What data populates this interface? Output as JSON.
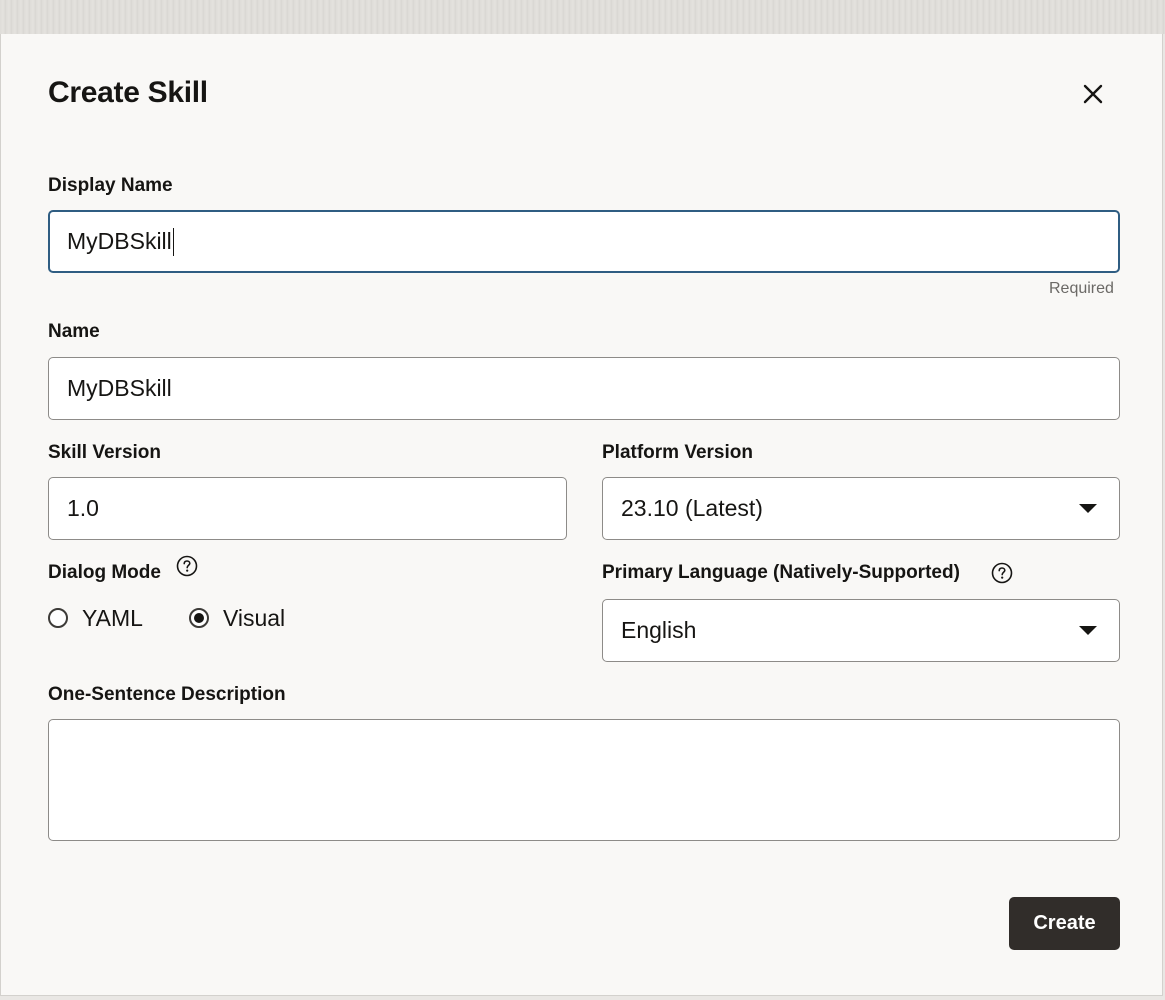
{
  "dialog": {
    "title": "Create Skill",
    "close_icon": "close-icon",
    "create_label": "Create"
  },
  "display_name": {
    "label": "Display Name",
    "value": "MyDBSkill",
    "helper": "Required"
  },
  "name": {
    "label": "Name",
    "value": "MyDBSkill"
  },
  "skill_version": {
    "label": "Skill Version",
    "value": "1.0"
  },
  "platform_version": {
    "label": "Platform Version",
    "selected": "23.10 (Latest)"
  },
  "dialog_mode": {
    "label": "Dialog Mode",
    "help_icon": "help-icon",
    "options": [
      {
        "label": "YAML",
        "selected": false
      },
      {
        "label": "Visual",
        "selected": true
      }
    ]
  },
  "primary_language": {
    "label": "Primary Language (Natively-Supported)",
    "help_icon": "help-icon",
    "selected": "English"
  },
  "description": {
    "label": "One-Sentence Description",
    "value": ""
  },
  "colors": {
    "focus_border": "#2f5d82",
    "primary_button": "#312d2a",
    "dialog_background": "#f9f8f6"
  }
}
